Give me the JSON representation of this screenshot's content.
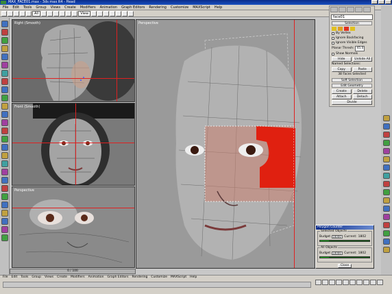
{
  "window": {
    "title": "MAX_FACE01.max - 3ds max R4 - Head"
  },
  "menu": [
    "File",
    "Edit",
    "Tools",
    "Group",
    "Views",
    "Create",
    "Modifiers",
    "Animation",
    "Graph Editors",
    "Rendering",
    "Customize",
    "MAXScript",
    "Help"
  ],
  "toolbar": {
    "selection_filter": "All",
    "view_dropdown": "View"
  },
  "viewports": {
    "right": {
      "label": "Right (Smooth)"
    },
    "front": {
      "label": "Front (Smooth)"
    },
    "left_persp": {
      "label": "Perspective"
    },
    "main": {
      "label": "Perspective"
    }
  },
  "command_panel": {
    "object_name": "face01",
    "selection_rollout": "Selection",
    "by_vertex": "By Vertex",
    "ignore_backfacing": "Ignore Backfacing",
    "ignore_visible_edges": "Ignore Visible Edges",
    "planar_thresh_label": "Planar Thresh:",
    "planar_thresh_value": "45.0",
    "show_normals": "Show Normals",
    "scale_label": "Scale:",
    "hide": "Hide",
    "unhide_all": "Unhide All",
    "named_selections": "Named Selections:",
    "copy": "Copy",
    "paste": "Paste",
    "faces_selected": "38 Faces Selected",
    "soft_selection": "Soft Selection",
    "edit_geometry": "Edit Geometry",
    "create": "Create",
    "delete": "Delete",
    "attach": "Attach",
    "detach": "Detach",
    "divide": "Divide"
  },
  "polygon_counter": {
    "title": "Polygon Counter",
    "selected_objects": "Selected Objects",
    "all_objects": "All Objects",
    "budget_label": "Budget",
    "current_label": "Current:",
    "selected_budget": "10000",
    "selected_current": "1802",
    "selected_progress": 0.18,
    "all_budget": "10000",
    "all_current": "1802",
    "all_progress": 0.18,
    "close": "Close"
  },
  "timebar": {
    "frame": "0 / 100"
  },
  "colors": {
    "titlebar": "#0a2c8a",
    "red_guide": "#e02020",
    "selection_red": "#e02010",
    "bar_green": "#20c020"
  }
}
